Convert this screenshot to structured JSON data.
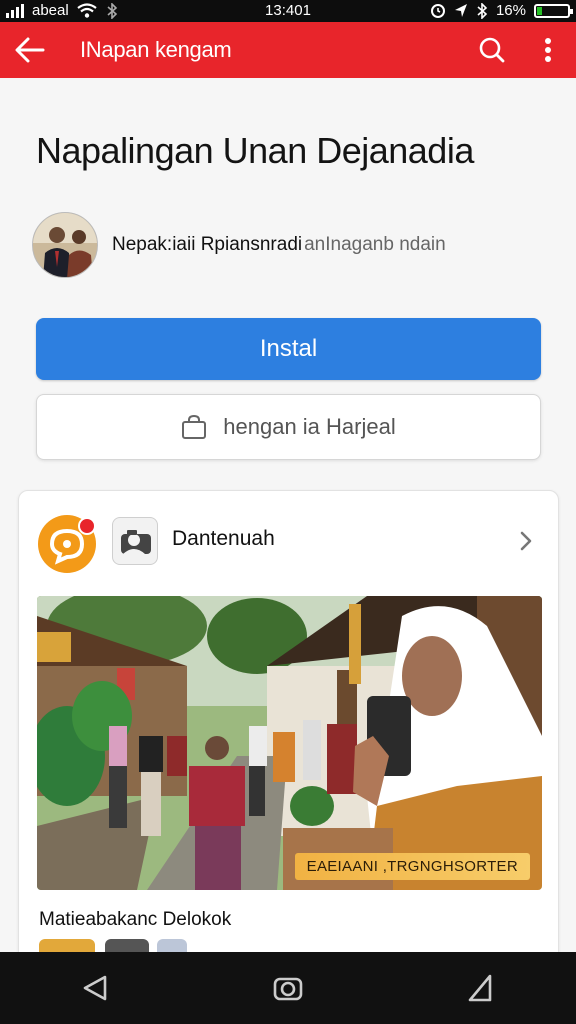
{
  "status_bar": {
    "carrier": "abeal",
    "time": "13:401",
    "battery": "16%",
    "battery_level": 0.16,
    "icons": [
      "signal-icon",
      "wifi-icon",
      "bluetooth-icon",
      "alarm-icon",
      "location-icon",
      "battery-icon"
    ]
  },
  "app_bar": {
    "title": "INapan kengam",
    "background": "#e8252b",
    "icons": [
      "back-arrow-icon",
      "search-icon",
      "more-vert-icon"
    ]
  },
  "app": {
    "title": "Napalingan Unan Dejanadia",
    "developer": "Nepak:iaii Rpiansnradi",
    "developer_sub": " anInaganb ndain",
    "install_label": "Instal",
    "install_color": "#2d7fe0",
    "wishlist_label": "hengan ia Harjeal"
  },
  "card": {
    "label": "Dantenuah",
    "photo_badge": "EAEIAANI ,TRGNGHSORTER",
    "caption": "Matieabakanc Delokok"
  },
  "nav_bar": {
    "icons": [
      "nav-back-icon",
      "nav-home-icon",
      "nav-recents-icon"
    ]
  }
}
